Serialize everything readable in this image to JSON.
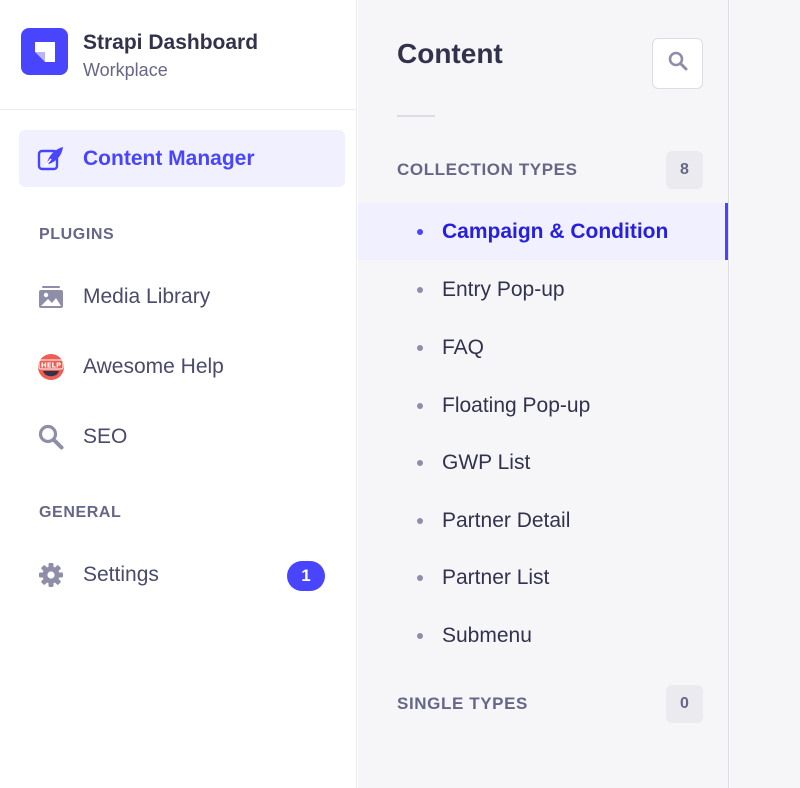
{
  "brand": {
    "title": "Strapi Dashboard",
    "subtitle": "Workplace",
    "logo_icon": "strapi-logo-icon",
    "color": "#4945ff"
  },
  "main_nav": {
    "content_manager": {
      "label": "Content Manager",
      "icon": "feather-icon",
      "active": true
    },
    "sections": {
      "plugins": "PLUGINS",
      "general": "GENERAL"
    },
    "plugins": [
      {
        "label": "Media Library",
        "icon": "image-icon"
      },
      {
        "label": "Awesome Help",
        "icon": "help-badge-icon"
      },
      {
        "label": "SEO",
        "icon": "search-icon"
      }
    ],
    "settings": {
      "label": "Settings",
      "icon": "gear-icon",
      "badge": "1"
    }
  },
  "sub_nav": {
    "title": "Content",
    "search_icon": "search-icon",
    "collection_types": {
      "label": "COLLECTION TYPES",
      "count": "8",
      "items": [
        {
          "label": "Campaign & Condition",
          "active": true
        },
        {
          "label": "Entry Pop-up"
        },
        {
          "label": "FAQ"
        },
        {
          "label": "Floating Pop-up"
        },
        {
          "label": "GWP List"
        },
        {
          "label": "Partner Detail"
        },
        {
          "label": "Partner List"
        },
        {
          "label": "Submenu"
        }
      ]
    },
    "single_types": {
      "label": "SINGLE TYPES",
      "count": "0"
    }
  },
  "colors": {
    "primary": "#4945ff",
    "active_bg": "#f0f0ff",
    "help_red": "#ee5e52"
  }
}
